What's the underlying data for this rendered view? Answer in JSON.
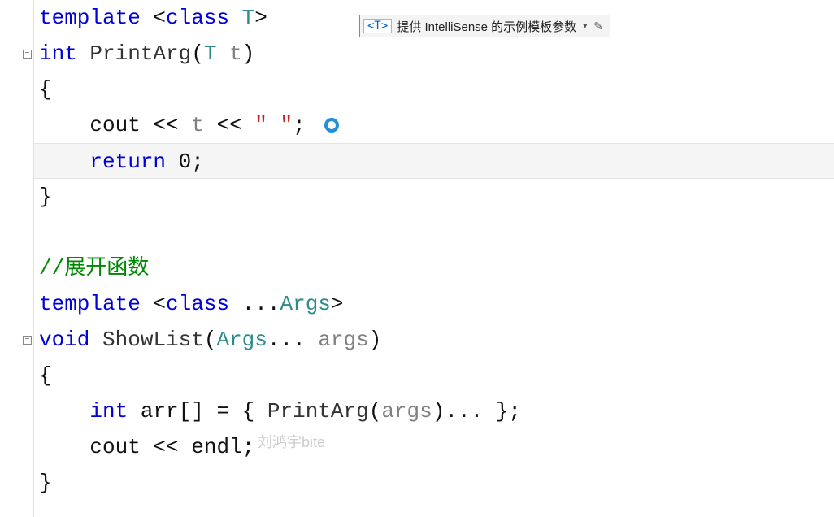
{
  "tooltip": {
    "typeParam": "<T>",
    "text": "提供 IntelliSense 的示例模板参数",
    "dropdownGlyph": "▾",
    "editGlyph": "✎"
  },
  "code": {
    "l1": {
      "kw1": "template",
      "p1": " <",
      "kw2": "class",
      "sp": " ",
      "tp": "T",
      "p2": ">"
    },
    "l2": {
      "kw": "int",
      "sp": " ",
      "fn": "PrintArg",
      "p1": "(",
      "tp": "T",
      "sp2": " ",
      "param": "t",
      "p2": ")"
    },
    "l3": {
      "brace": "{"
    },
    "l4": {
      "indent": "    ",
      "obj": "cout",
      "op1": " << ",
      "param": "t",
      "op2": " << ",
      "str": "\" \"",
      "semi": ";"
    },
    "l5": {
      "indent": "    ",
      "kw": "return",
      "sp": " ",
      "num": "0",
      "semi": ";"
    },
    "l6": {
      "brace": "}"
    },
    "l7": {
      "blank": ""
    },
    "l8": {
      "comment": "//展开函数"
    },
    "l9": {
      "kw1": "template",
      "p1": " <",
      "kw2": "class",
      "sp": " ",
      "dots": "...",
      "tp": "Args",
      "p2": ">"
    },
    "l10": {
      "kw": "void",
      "sp": " ",
      "fn": "ShowList",
      "p1": "(",
      "tp": "Args",
      "dots": "... ",
      "param": "args",
      "p2": ")"
    },
    "l11": {
      "brace": "{"
    },
    "l12": {
      "indent": "    ",
      "kw": "int",
      "sp": " ",
      "var": "arr",
      "br": "[]",
      "eq": " = { ",
      "fn": "PrintArg",
      "p1": "(",
      "param": "args",
      "p2": ")",
      "dots": "... ",
      "end": "};"
    },
    "l13": {
      "indent": "    ",
      "obj": "cout",
      "op": " << ",
      "endl": "endl",
      "semi": ";"
    },
    "l14": {
      "brace": "}"
    }
  },
  "watermark": "刘鸿宇bite",
  "foldGlyph": "−"
}
